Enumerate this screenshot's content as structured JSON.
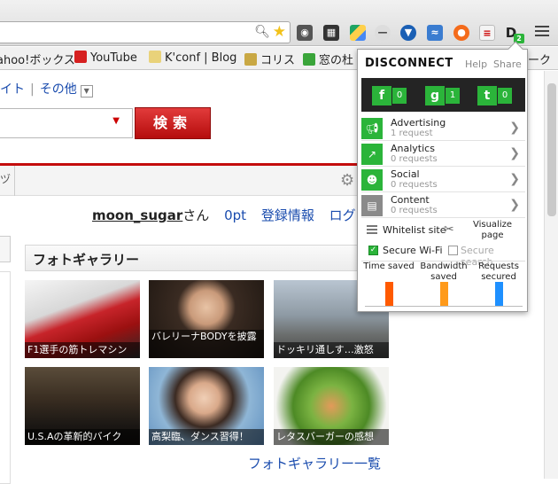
{
  "toolbar": {
    "menu_icon": "hamburger-menu-icon"
  },
  "bookmarks": [
    {
      "label": "ahoo!ボックス",
      "icon": "none"
    },
    {
      "label": "YouTube",
      "icon": "youtube-icon",
      "color": "#d62020"
    },
    {
      "label": "K'conf | Blog",
      "icon": "bookmark-icon",
      "color": "#e9d27a"
    },
    {
      "label": "コリス",
      "icon": "coliss-icon",
      "color": "#c9a844"
    },
    {
      "label": "窓の杜",
      "icon": "madonomori-icon",
      "color": "#3aa53a"
    },
    {
      "label": "ーク",
      "icon": "none"
    }
  ],
  "page": {
    "topnav": [
      "イト",
      "その他"
    ],
    "search_button": "検索",
    "username": "moon_sugar",
    "honorific": "さん",
    "points": "0pt",
    "account_link": "登録情報",
    "logout_link": "ログア",
    "gallery_title": "フォトギャラリー",
    "gallery_link": "フォトギャラリー一覧",
    "photos": [
      {
        "caption": "F1選手の筋トレマシン"
      },
      {
        "caption": "バレリーナBODYを披露"
      },
      {
        "caption": "ドッキリ通しす…激怒"
      },
      {
        "caption": "U.S.Aの革新的バイク"
      },
      {
        "caption": "高梨臨、ダンス習得！"
      },
      {
        "caption": "レタスバーガーの感想"
      }
    ]
  },
  "popup": {
    "title": "DISCONNECT",
    "help": "Help",
    "share": "Share",
    "badge_count": "2",
    "social": [
      {
        "name": "facebook",
        "letter": "f",
        "count": "0"
      },
      {
        "name": "google",
        "letter": "g",
        "count": "1"
      },
      {
        "name": "twitter",
        "letter": "t",
        "count": "0"
      }
    ],
    "categories": [
      {
        "name": "Advertising",
        "requests": "1 request",
        "icon": "megaphone-icon",
        "active": true
      },
      {
        "name": "Analytics",
        "requests": "0 requests",
        "icon": "chart-icon",
        "active": true
      },
      {
        "name": "Social",
        "requests": "0 requests",
        "icon": "people-icon",
        "active": true
      },
      {
        "name": "Content",
        "requests": "0 requests",
        "icon": "content-icon",
        "active": false
      }
    ],
    "whitelist": "Whitelist site",
    "visualize": "Visualize page",
    "secure_wifi": "Secure Wi-Fi",
    "secure_search": "Secure search",
    "metrics": [
      {
        "label": "Time saved",
        "color": "#ff5a00",
        "fraction": 0.75
      },
      {
        "label": "Bandwidth saved",
        "color": "#ff9a1a",
        "fraction": 0.75
      },
      {
        "label": "Requests secured",
        "color": "#1e90ff",
        "fraction": 0.75
      }
    ]
  }
}
